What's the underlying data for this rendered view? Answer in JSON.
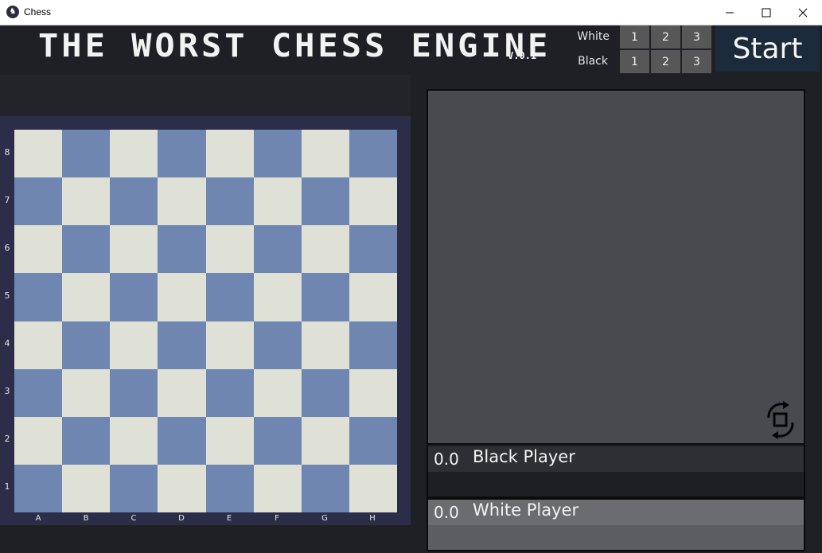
{
  "window": {
    "title": "Chess",
    "controls": [
      "minimize-icon",
      "maximize-icon",
      "close-icon"
    ]
  },
  "header": {
    "title": "THE WORST CHESS ENGINE",
    "version": "V.0.1"
  },
  "players": {
    "white": {
      "label": "White",
      "levels": [
        "1",
        "2",
        "3"
      ]
    },
    "black": {
      "label": "Black",
      "levels": [
        "1",
        "2",
        "3"
      ]
    }
  },
  "start_button": "Start",
  "board": {
    "ranks": [
      "8",
      "7",
      "6",
      "5",
      "4",
      "3",
      "2",
      "1"
    ],
    "files": [
      "A",
      "B",
      "C",
      "D",
      "E",
      "F",
      "G",
      "H"
    ],
    "light_color": "#dfe0d6",
    "dark_color": "#6e86b0"
  },
  "scoreboard": {
    "black": {
      "score": "0.0",
      "name": "Black Player"
    },
    "white": {
      "score": "0.0",
      "name": "White Player"
    }
  },
  "icons": {
    "flip": "rotate-board-icon"
  }
}
